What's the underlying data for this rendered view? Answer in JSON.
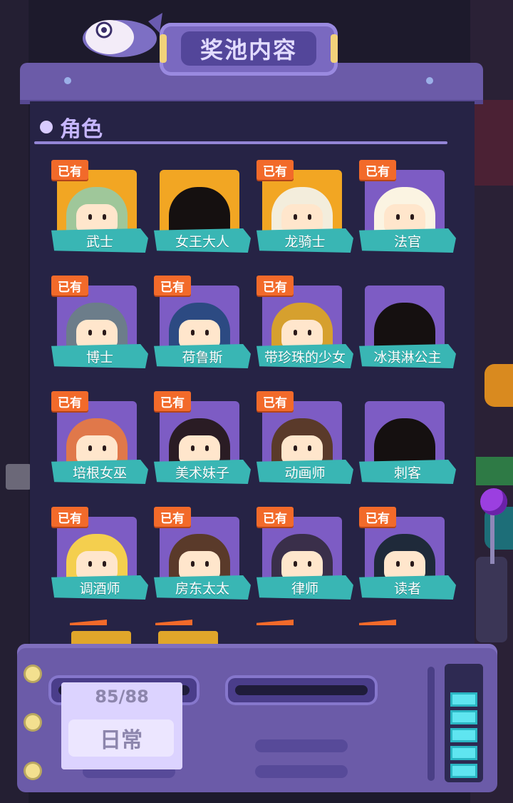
{
  "header": {
    "title": "奖池内容"
  },
  "section": {
    "title": "角色"
  },
  "badge_owned": "已有",
  "characters": [
    {
      "name": "武士",
      "owned": true,
      "card": "gold",
      "hair": "#9fc79a"
    },
    {
      "name": "女王大人",
      "owned": false,
      "card": "gold",
      "hair": "#151010"
    },
    {
      "name": "龙骑士",
      "owned": true,
      "card": "gold",
      "hair": "#f3eddc"
    },
    {
      "name": "法官",
      "owned": true,
      "card": "purple",
      "hair": "#fbf4e2"
    },
    {
      "name": "博士",
      "owned": true,
      "card": "purple",
      "hair": "#6c7d8a"
    },
    {
      "name": "荷鲁斯",
      "owned": true,
      "card": "purple",
      "hair": "#2c4a82"
    },
    {
      "name": "带珍珠的少女",
      "owned": true,
      "card": "purple",
      "hair": "#d6a02e"
    },
    {
      "name": "冰淇淋公主",
      "owned": false,
      "card": "purple",
      "hair": "#151010"
    },
    {
      "name": "培根女巫",
      "owned": true,
      "card": "purple",
      "hair": "#e0784a"
    },
    {
      "name": "美术妹子",
      "owned": true,
      "card": "purple",
      "hair": "#2a1c24"
    },
    {
      "name": "动画师",
      "owned": true,
      "card": "purple",
      "hair": "#5a3a2a"
    },
    {
      "name": "刺客",
      "owned": false,
      "card": "purple",
      "hair": "#151010"
    },
    {
      "name": "调酒师",
      "owned": true,
      "card": "purple",
      "hair": "#f4cf4e"
    },
    {
      "name": "房东太太",
      "owned": true,
      "card": "purple",
      "hair": "#5a3a2a"
    },
    {
      "name": "律师",
      "owned": true,
      "card": "purple",
      "hair": "#3a2f4a"
    },
    {
      "name": "读者",
      "owned": true,
      "card": "purple",
      "hair": "#1f2a3a"
    }
  ],
  "footer": {
    "counter": "85/88",
    "mode": "日常"
  },
  "meter_segments_lit": 5
}
